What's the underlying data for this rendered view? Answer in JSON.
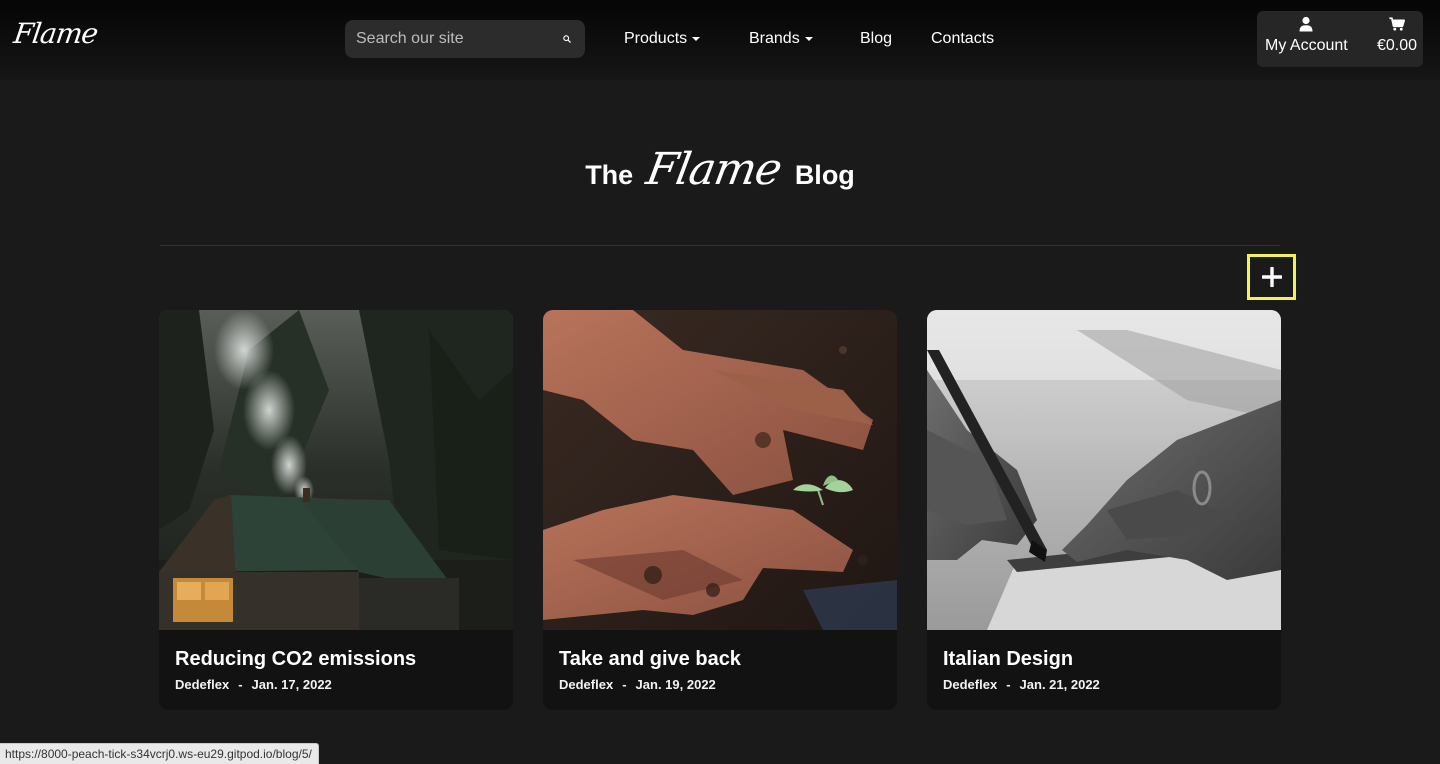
{
  "header": {
    "logo": "Flame",
    "search": {
      "placeholder": "Search our site"
    },
    "nav": [
      {
        "label": "Products"
      },
      {
        "label": "Brands"
      },
      {
        "label": "Blog"
      },
      {
        "label": "Contacts"
      }
    ],
    "account": {
      "label": "My Account",
      "icon": "user-icon"
    },
    "cart": {
      "total": "€0.00",
      "icon": "cart-icon"
    }
  },
  "page": {
    "title_before": "The",
    "title_script": "Flame",
    "title_after": "Blog",
    "add_button_icon": "plus-icon",
    "add_button_highlight": "#f3f05a"
  },
  "posts": [
    {
      "title": "Reducing CO2 emissions",
      "author": "Dedeflex",
      "date": "Jan. 17, 2022"
    },
    {
      "title": "Take and give back",
      "author": "Dedeflex",
      "date": "Jan. 19, 2022"
    },
    {
      "title": "Italian Design",
      "author": "Dedeflex",
      "date": "Jan. 21, 2022"
    }
  ],
  "meta_separator": "-",
  "status_url": "https://8000-peach-tick-s34vcrj0.ws-eu29.gitpod.io/blog/5/"
}
